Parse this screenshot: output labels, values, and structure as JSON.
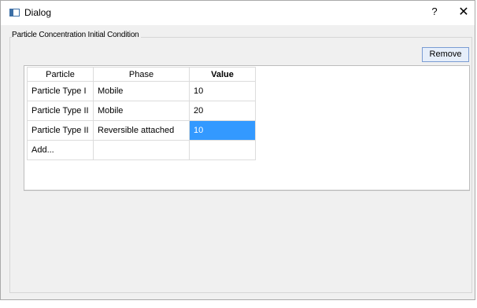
{
  "window": {
    "title": "Dialog",
    "help_label": "?",
    "close_label": "✕"
  },
  "group": {
    "label": "Particle Concentration Initial Condition"
  },
  "toolbar": {
    "remove_label": "Remove"
  },
  "table": {
    "columns": [
      "Particle",
      "Phase",
      "Value"
    ],
    "rows": [
      {
        "particle": "Particle Type I",
        "phase": "Mobile",
        "value": "10"
      },
      {
        "particle": "Particle Type II",
        "phase": "Mobile",
        "value": "20"
      },
      {
        "particle": "Particle Type II",
        "phase": "Reversible attached",
        "value": "10"
      },
      {
        "particle": "Add...",
        "phase": "",
        "value": ""
      }
    ],
    "selected_row": 2,
    "selected_column": 2
  },
  "colors": {
    "selection": "#3399ff",
    "remove_button_border": "#7a9cd3"
  },
  "icons": {
    "title_icon": "window-icon"
  }
}
